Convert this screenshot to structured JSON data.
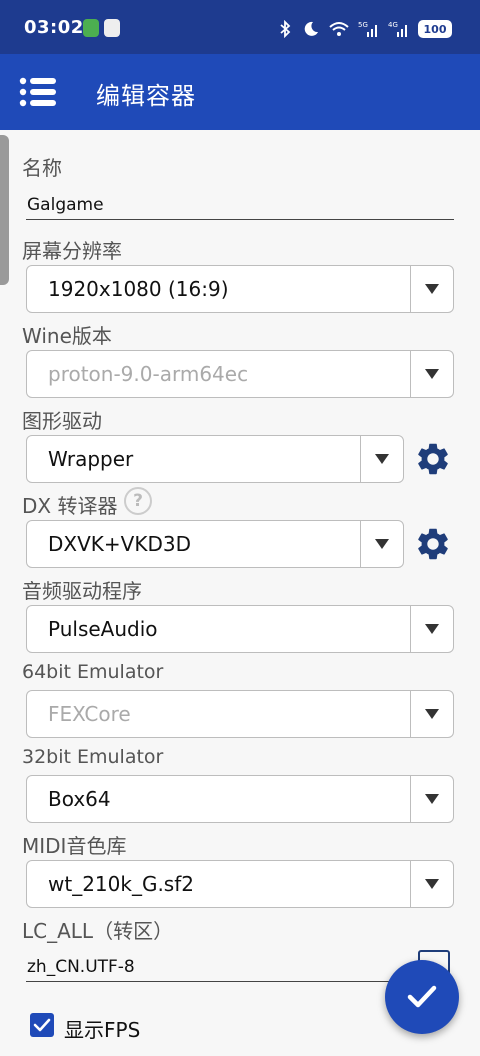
{
  "statusbar": {
    "time": "03:02",
    "battery": "100",
    "network": [
      "5G",
      "4G"
    ]
  },
  "appbar": {
    "menu_icon": "hamburger-menu-icon",
    "title": "编辑容器"
  },
  "form": {
    "name": {
      "label": "名称",
      "value": "Galgame"
    },
    "resolution": {
      "label": "屏幕分辨率",
      "value": "1920x1080 (16:9)"
    },
    "wine": {
      "label": "Wine版本",
      "value": "proton-9.0-arm64ec",
      "disabled": true
    },
    "graphics": {
      "label": "图形驱动",
      "value": "Wrapper",
      "settings_icon": "gear-icon"
    },
    "dx": {
      "label": "DX 转译器",
      "help": "?",
      "value": "DXVK+VKD3D",
      "settings_icon": "gear-icon"
    },
    "audio": {
      "label": "音频驱动程序",
      "value": "PulseAudio"
    },
    "emu64": {
      "label": "64bit Emulator",
      "value": "FEXCore",
      "disabled": true
    },
    "emu32": {
      "label": "32bit Emulator",
      "value": "Box64"
    },
    "midi": {
      "label": "MIDI音色库",
      "value": "wt_210k_G.sf2"
    },
    "lc_all": {
      "label": "LC_ALL（转区）",
      "value": "zh_CN.UTF-8"
    },
    "show_fps": {
      "label": "显示FPS",
      "checked": true
    }
  },
  "fab": {
    "icon": "checkmark-icon"
  },
  "colors": {
    "statusbar": "#1e3b8f",
    "appbar": "#1f4ab8",
    "accent": "#1f4ab8",
    "gear": "#1f3d7a"
  }
}
